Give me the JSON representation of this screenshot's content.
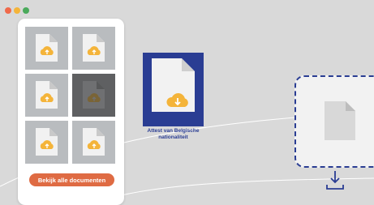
{
  "window_controls": {
    "colors": [
      "#f0694a",
      "#f4b43a",
      "#4aaa5b"
    ],
    "names": [
      "close",
      "minimize",
      "maximize"
    ]
  },
  "documents": {
    "tile_count": 6,
    "selected_index": 3,
    "icon": "file-upload-icon",
    "button_label": "Bekijk alle documenten"
  },
  "featured_document": {
    "caption_line1": "Attest van Belgische",
    "caption_line2": "nationaliteit",
    "icon": "file-download-icon"
  },
  "dropzone": {
    "icon": "file-icon"
  },
  "download_icon": "download-tray-icon",
  "colors": {
    "accent": "#df6b43",
    "brand_blue": "#2a3d93",
    "cloud_yellow": "#f4b43a",
    "background": "#d9d9d9"
  }
}
